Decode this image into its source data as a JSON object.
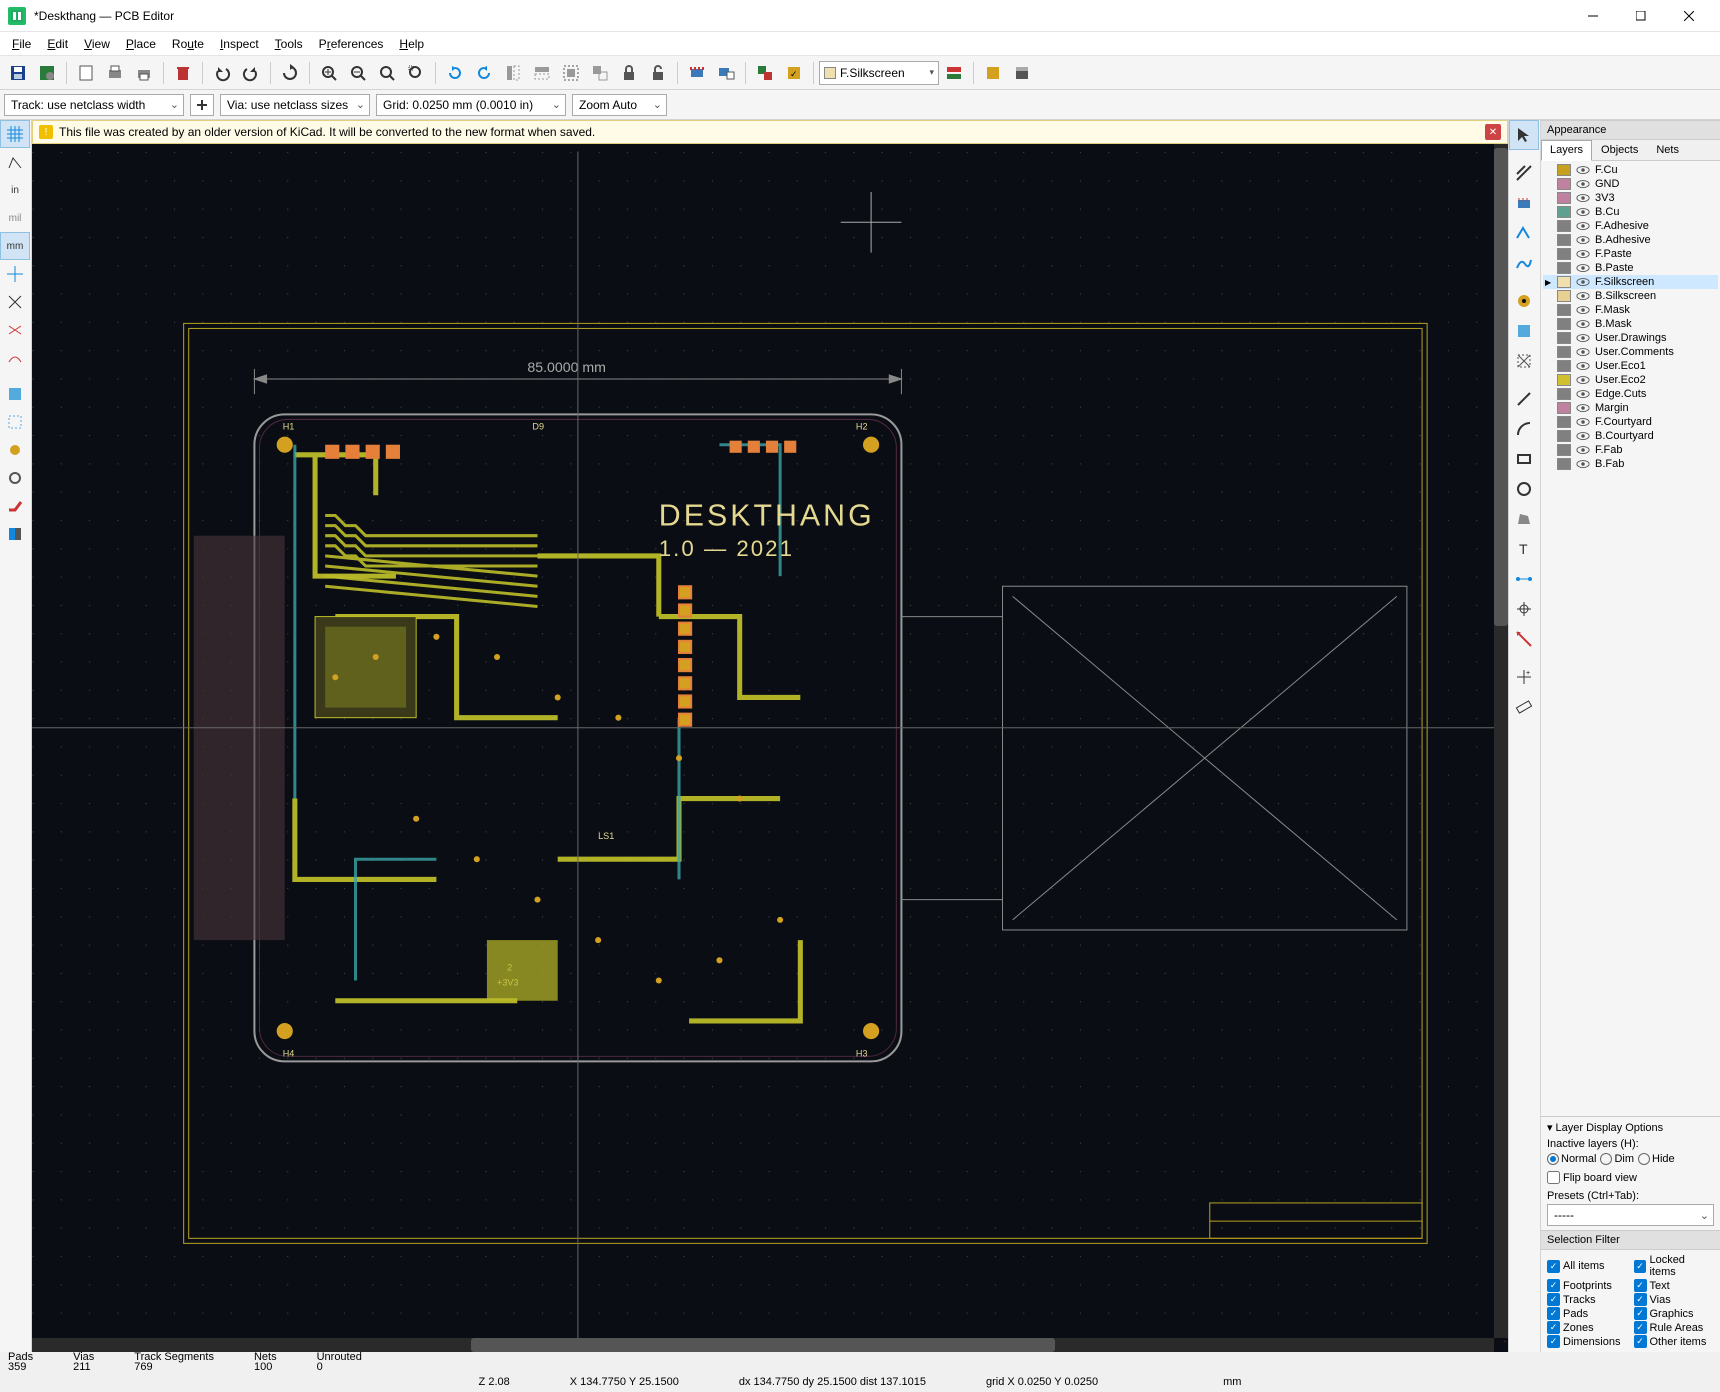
{
  "window": {
    "title": "*Deskthang — PCB Editor",
    "app_icon": "kicad"
  },
  "menu": [
    "File",
    "Edit",
    "View",
    "Place",
    "Route",
    "Inspect",
    "Tools",
    "Preferences",
    "Help"
  ],
  "toolbar_combo": "F.Silkscreen",
  "secondbar": {
    "track": "Track: use netclass width",
    "via": "Via: use netclass sizes",
    "grid": "Grid: 0.0250 mm (0.0010 in)",
    "zoom": "Zoom Auto"
  },
  "info_message": "This file was created by an older version of KiCad. It will be converted to the new format when saved.",
  "left_tools": [
    {
      "name": "grid-icon",
      "label": "",
      "active": true
    },
    {
      "name": "polar-icon",
      "label": ""
    },
    {
      "name": "inch-unit",
      "label": "in"
    },
    {
      "name": "mil-unit",
      "label": "mil"
    },
    {
      "name": "mm-unit",
      "label": "mm",
      "active": true
    },
    {
      "name": "cursor-full",
      "label": ""
    },
    {
      "name": "cut-icon",
      "label": ""
    },
    {
      "name": "ratsnest-icon",
      "label": ""
    },
    {
      "name": "curved-ratsnest",
      "label": ""
    },
    {
      "name": "sep",
      "label": ""
    },
    {
      "name": "zone-fill",
      "label": ""
    },
    {
      "name": "zone-outline",
      "label": ""
    },
    {
      "name": "pad-mode",
      "label": ""
    },
    {
      "name": "via-mode",
      "label": ""
    },
    {
      "name": "track-mode",
      "label": ""
    },
    {
      "name": "contrast-mode",
      "label": ""
    }
  ],
  "right_tools": [
    "select",
    "highlight",
    "ratsnest",
    "footprint",
    "route-track",
    "route-diff",
    "tune-length",
    "via",
    "zone",
    "rule-area",
    "line",
    "arc",
    "rect",
    "circle",
    "poly",
    "text",
    "dimension",
    "origin",
    "measure",
    "sep",
    "grid-origin",
    "drill-origin"
  ],
  "appearance": {
    "title": "Appearance",
    "tabs": [
      "Layers",
      "Objects",
      "Nets"
    ],
    "layers": [
      {
        "name": "F.Cu",
        "color": "#c8a020"
      },
      {
        "name": "GND",
        "color": "#c080a0"
      },
      {
        "name": "3V3",
        "color": "#c080a0"
      },
      {
        "name": "B.Cu",
        "color": "#60a090"
      },
      {
        "name": "F.Adhesive",
        "color": "#808080"
      },
      {
        "name": "B.Adhesive",
        "color": "#808080"
      },
      {
        "name": "F.Paste",
        "color": "#808080"
      },
      {
        "name": "B.Paste",
        "color": "#808080"
      },
      {
        "name": "F.Silkscreen",
        "color": "#f0e0b0",
        "selected": true
      },
      {
        "name": "B.Silkscreen",
        "color": "#e8d090"
      },
      {
        "name": "F.Mask",
        "color": "#808080"
      },
      {
        "name": "B.Mask",
        "color": "#808080"
      },
      {
        "name": "User.Drawings",
        "color": "#808080"
      },
      {
        "name": "User.Comments",
        "color": "#808080"
      },
      {
        "name": "User.Eco1",
        "color": "#808080"
      },
      {
        "name": "User.Eco2",
        "color": "#d0c030"
      },
      {
        "name": "Edge.Cuts",
        "color": "#808080"
      },
      {
        "name": "Margin",
        "color": "#c080a0"
      },
      {
        "name": "F.Courtyard",
        "color": "#808080"
      },
      {
        "name": "B.Courtyard",
        "color": "#808080"
      },
      {
        "name": "F.Fab",
        "color": "#808080"
      },
      {
        "name": "B.Fab",
        "color": "#808080"
      }
    ]
  },
  "layer_display": {
    "title": "Layer Display Options",
    "inactive_label": "Inactive layers (H):",
    "options": [
      "Normal",
      "Dim",
      "Hide"
    ],
    "selected": "Normal",
    "flip_label": "Flip board view",
    "presets_label": "Presets (Ctrl+Tab):",
    "presets_value": "-----"
  },
  "selection_filter": {
    "title": "Selection Filter",
    "items_left": [
      "All items",
      "Footprints",
      "Tracks",
      "Pads",
      "Zones",
      "Dimensions"
    ],
    "items_right": [
      "Locked items",
      "Text",
      "Vias",
      "Graphics",
      "Rule Areas",
      "Other items"
    ]
  },
  "status1": {
    "pads_label": "Pads",
    "pads": "359",
    "vias_label": "Vias",
    "vias": "211",
    "tracks_label": "Track Segments",
    "tracks": "769",
    "nets_label": "Nets",
    "nets": "100",
    "unrouted_label": "Unrouted",
    "unrouted": "0"
  },
  "status2": {
    "z": "Z 2.08",
    "xy": "X 134.7750  Y 25.1500",
    "dxy": "dx 134.7750  dy 25.1500  dist 137.1015",
    "grid": "grid X 0.0250  Y 0.0250",
    "unit": "mm"
  },
  "board": {
    "title_text": "DESKTHANG",
    "version_text": "1.0 — 2021",
    "dimension": "85.0000  mm"
  }
}
